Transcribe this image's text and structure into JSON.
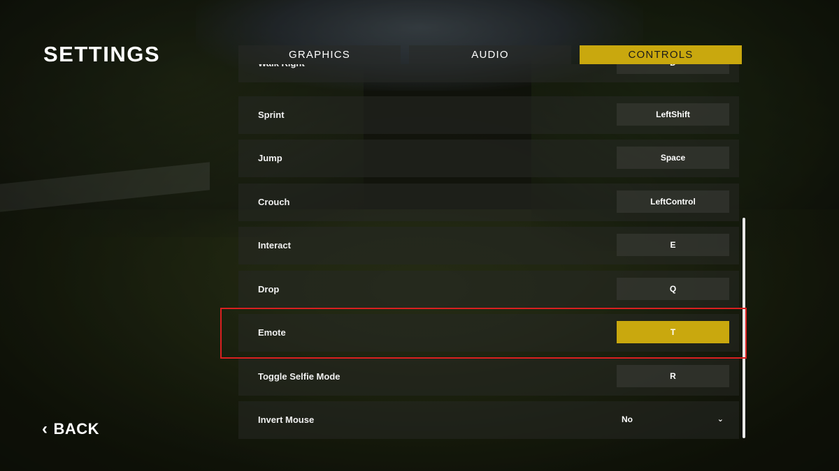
{
  "title": "SETTINGS",
  "back": {
    "label": "BACK",
    "icon": "chevron-left-icon"
  },
  "tabs": [
    {
      "label": "GRAPHICS",
      "active": false
    },
    {
      "label": "AUDIO",
      "active": false
    },
    {
      "label": "CONTROLS",
      "active": true
    }
  ],
  "colors": {
    "accent": "#c9a80e",
    "highlight_border": "#d92020"
  },
  "bindings": [
    {
      "action": "Walk Right",
      "key": "D"
    },
    {
      "action": "Sprint",
      "key": "LeftShift"
    },
    {
      "action": "Jump",
      "key": "Space"
    },
    {
      "action": "Crouch",
      "key": "LeftControl"
    },
    {
      "action": "Interact",
      "key": "E"
    },
    {
      "action": "Drop",
      "key": "Q"
    },
    {
      "action": "Emote",
      "key": "T"
    },
    {
      "action": "Toggle Selfie Mode",
      "key": "R"
    }
  ],
  "invert_mouse": {
    "label": "Invert Mouse",
    "value": "No"
  }
}
